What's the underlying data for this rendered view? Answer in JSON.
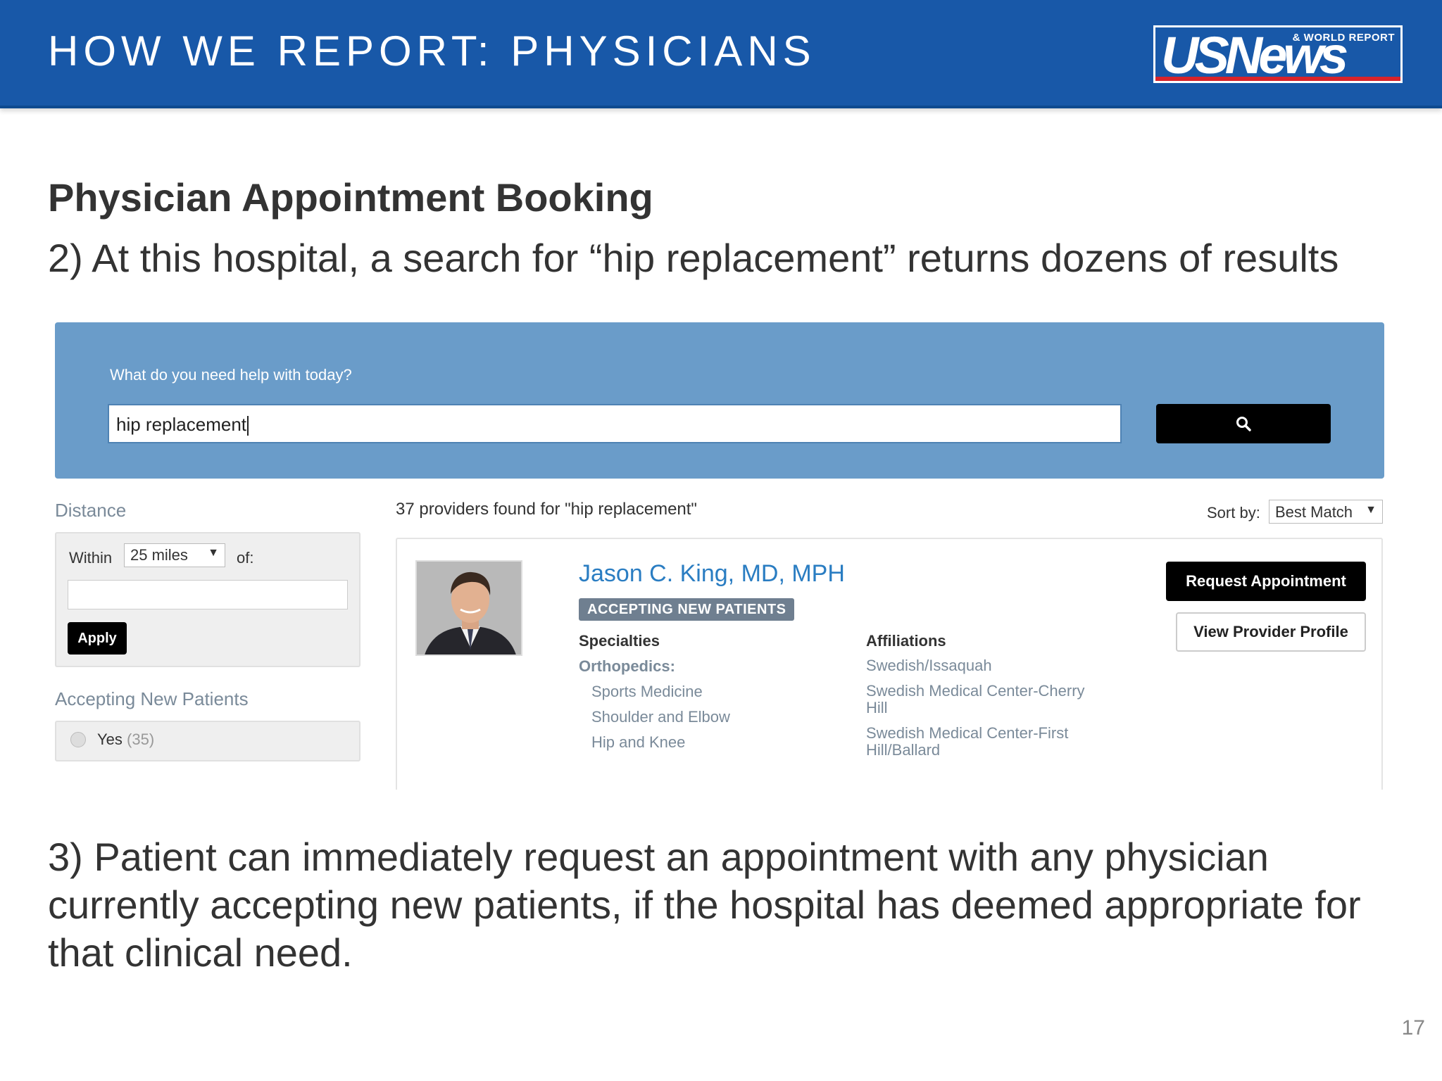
{
  "header": {
    "title": "HOW WE REPORT: PHYSICIANS",
    "logo_main": "USNews",
    "logo_sub": "& WORLD REPORT"
  },
  "slide": {
    "section_title": "Physician Appointment Booking",
    "step_2": "2) At this hospital, a search for “hip replacement” returns dozens of results",
    "step_3": "3) Patient can immediately request an appointment with any physician currently accepting new patients, if the hospital has deemed appropriate for that clinical need.",
    "page_number": "17"
  },
  "search": {
    "prompt": "What do you need help with today?",
    "value": "hip replacement",
    "button_icon": "search-icon"
  },
  "filters": {
    "distance_heading": "Distance",
    "within_label": "Within",
    "distance_selected": "25 miles",
    "of_label": "of:",
    "location_value": "",
    "apply_label": "Apply",
    "accepting_heading": "Accepting New Patients",
    "yes_label": "Yes",
    "yes_count": "(35)"
  },
  "results": {
    "count_text": "37 providers found for \"hip replacement\"",
    "sort_label": "Sort by:",
    "sort_selected": "Best Match"
  },
  "provider": {
    "name": "Jason C. King, MD, MPH",
    "badge": "ACCEPTING NEW PATIENTS",
    "specialties_heading": "Specialties",
    "specialty_category": "Orthopedics:",
    "specialties": [
      "Sports Medicine",
      "Shoulder and Elbow",
      "Hip and Knee"
    ],
    "affiliations_heading": "Affiliations",
    "affiliations": [
      "Swedish/Issaquah",
      "Swedish Medical Center-Cherry Hill",
      "Swedish Medical Center-First Hill/Ballard"
    ],
    "request_label": "Request Appointment",
    "profile_label": "View Provider Profile"
  },
  "colors": {
    "header_bg": "#1858a8",
    "search_panel_bg": "#6a9cc9",
    "link_blue": "#2a7dc2",
    "badge_bg": "#6f7f90"
  }
}
